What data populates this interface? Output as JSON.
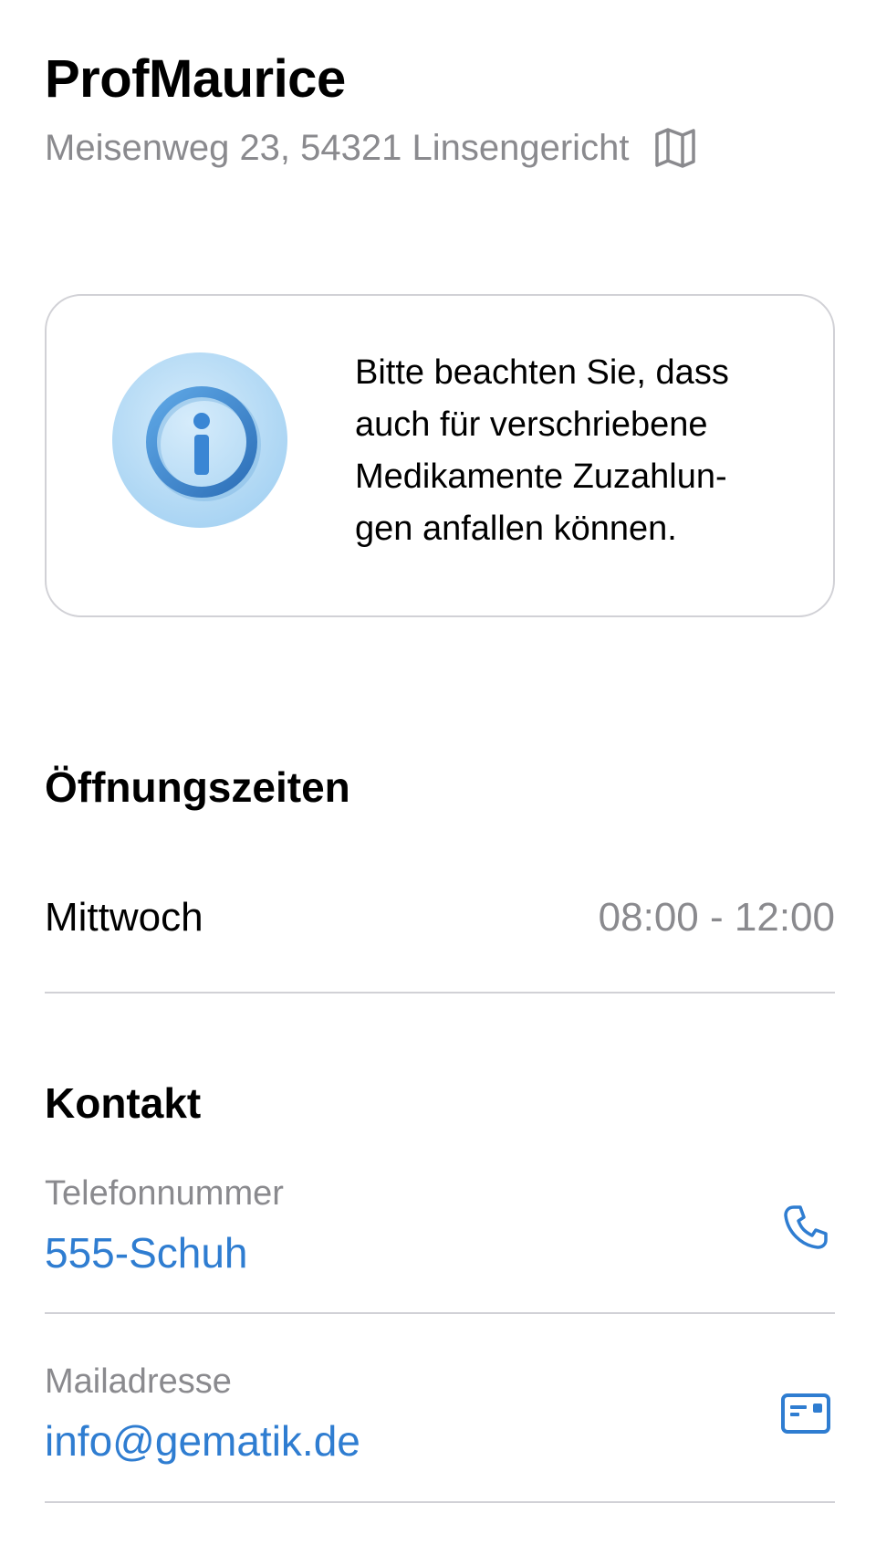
{
  "header": {
    "title": "ProfMaurice",
    "address": "Meisenweg 23, 54321 Linsengericht",
    "map_icon": "map-icon"
  },
  "hint": {
    "illustration_icon": "info-icon",
    "text": "Bitte beachten Sie, dass auch für verschriebene Medikamente Zuzahlungen anfallen können.",
    "lines": [
      "Bitte beachten Sie, dass",
      "auch für verschriebene",
      "Medikamente Zuzahlun-",
      "gen anfallen können."
    ]
  },
  "opening_hours": {
    "heading": "Öffnungszeiten",
    "rows": [
      {
        "day": "Mittwoch",
        "time": "08:00 - 12:00"
      }
    ]
  },
  "contact": {
    "heading": "Kontakt",
    "phone": {
      "label": "Telefonnummer",
      "value": "555-Schuh",
      "icon": "phone-icon"
    },
    "mail": {
      "label": "Mailadresse",
      "value": "info@gematik.de",
      "icon": "mail-icon"
    }
  },
  "colors": {
    "accent": "#2f7dd1",
    "secondary_text": "#8a8a8e",
    "divider": "#d1d1d6",
    "info_circle": "#bfe0f7"
  }
}
